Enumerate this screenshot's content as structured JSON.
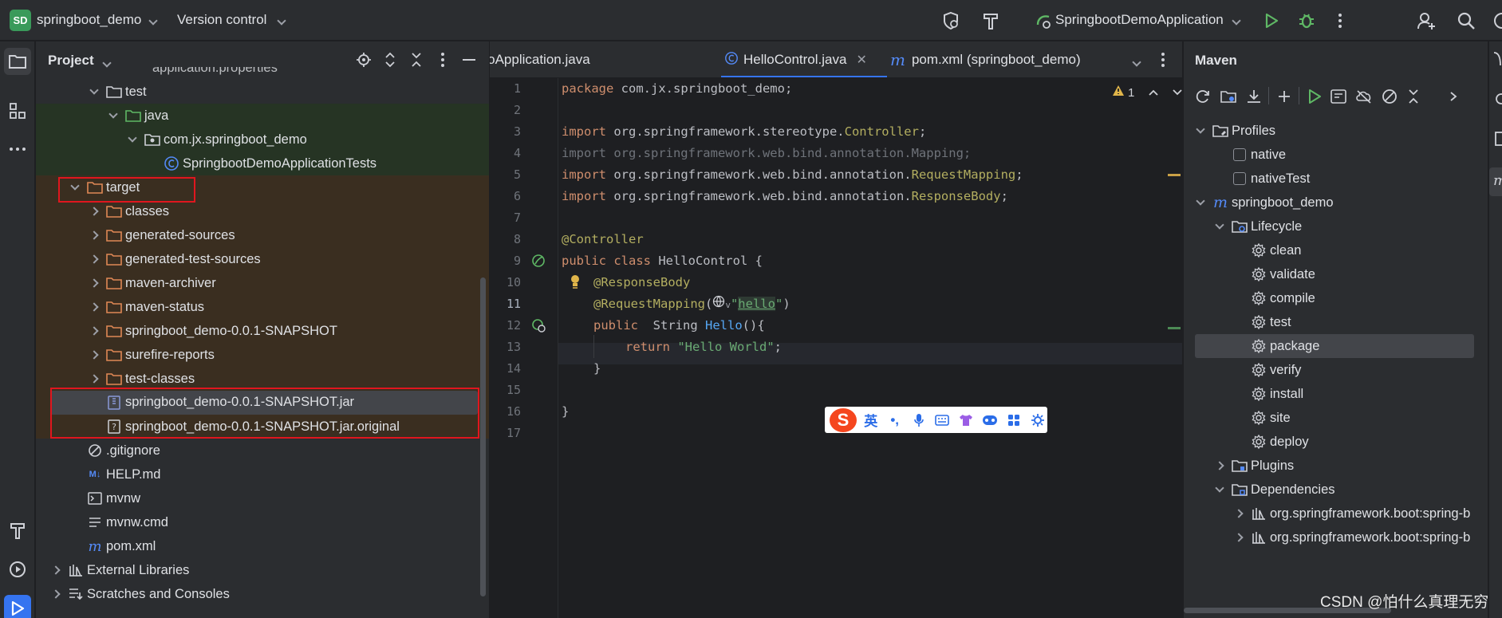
{
  "titlebar": {
    "project_badge": "SD",
    "project_name": "springboot_demo",
    "vcs_label": "Version control",
    "run_config": "SpringbootDemoApplication"
  },
  "project_panel": {
    "title": "Project",
    "partial_top_item": "application.properties",
    "tree": [
      {
        "label": "test",
        "icon": "folder-icon",
        "expanded": true
      },
      {
        "label": "java",
        "icon": "test-source-folder-icon",
        "expanded": true
      },
      {
        "label": "com.jx.springboot_demo",
        "icon": "package-icon",
        "expanded": true
      },
      {
        "label": "SpringbootDemoApplicationTests",
        "icon": "class-icon"
      },
      {
        "label": "target",
        "icon": "folder-icon",
        "expanded": true
      },
      {
        "label": "classes",
        "icon": "folder-icon",
        "expanded": false
      },
      {
        "label": "generated-sources",
        "icon": "folder-icon",
        "expanded": false
      },
      {
        "label": "generated-test-sources",
        "icon": "folder-icon",
        "expanded": false
      },
      {
        "label": "maven-archiver",
        "icon": "folder-icon",
        "expanded": false
      },
      {
        "label": "maven-status",
        "icon": "folder-icon",
        "expanded": false
      },
      {
        "label": "springboot_demo-0.0.1-SNAPSHOT",
        "icon": "folder-icon",
        "expanded": false
      },
      {
        "label": "surefire-reports",
        "icon": "folder-icon",
        "expanded": false
      },
      {
        "label": "test-classes",
        "icon": "folder-icon",
        "expanded": false
      },
      {
        "label": "springboot_demo-0.0.1-SNAPSHOT.jar",
        "icon": "jar-icon"
      },
      {
        "label": "springboot_demo-0.0.1-SNAPSHOT.jar.original",
        "icon": "unknown-file-icon"
      },
      {
        "label": ".gitignore",
        "icon": "ignore-file-icon"
      },
      {
        "label": "HELP.md",
        "icon": "markdown-icon"
      },
      {
        "label": "mvnw",
        "icon": "shell-icon"
      },
      {
        "label": "mvnw.cmd",
        "icon": "text-file-icon"
      },
      {
        "label": "pom.xml",
        "icon": "maven-icon"
      },
      {
        "label": "External Libraries",
        "icon": "library-icon",
        "expanded": false
      },
      {
        "label": "Scratches and Consoles",
        "icon": "scratches-icon",
        "expanded": false
      }
    ]
  },
  "editor": {
    "tabs": [
      {
        "label": "SpringbootDemoApplication.java"
      },
      {
        "label": "HelloControl.java",
        "active": true
      },
      {
        "label": "pom.xml (springboot_demo)"
      }
    ],
    "warning_count": "1",
    "line_numbers": [
      "1",
      "2",
      "3",
      "4",
      "5",
      "6",
      "7",
      "8",
      "9",
      "10",
      "11",
      "12",
      "13",
      "14",
      "15",
      "16",
      "17"
    ],
    "current_line": "11",
    "code": {
      "l1_kw": "package",
      "l1_rest": " com.jx.springboot_demo;",
      "l3_kw": "import",
      "l3_pkg": " org.springframework.stereotype.",
      "l3_cls": "Controller",
      "l3_end": ";",
      "l4_text": "import org.springframework.web.bind.annotation.Mapping;",
      "l5_kw": "import",
      "l5_pkg": " org.springframework.web.bind.annotation.",
      "l5_cls": "RequestMapping",
      "l5_end": ";",
      "l6_kw": "import",
      "l6_pkg": " org.springframework.web.bind.annotation.",
      "l6_cls": "ResponseBody",
      "l6_end": ";",
      "l8_ann": "@Controller",
      "l9_kw": "public class",
      "l9_rest": " HelloControl {",
      "l10_ann": "@ResponseBody",
      "l11_ann": "@RequestMapping",
      "l11_open": "(",
      "l11_chev": "v",
      "l11_q1": "\"",
      "l11_str": "hello",
      "l11_q2": "\"",
      "l11_close": ")",
      "l12_kw": "public",
      "l12_type": "  String ",
      "l12_fn": "Hello",
      "l12_end": "(){",
      "l13_kw": "return",
      "l13_str": " \"Hello World\"",
      "l13_end": ";",
      "l14": "}",
      "l16": "}"
    }
  },
  "ime_toolbar": {
    "logo": "S",
    "lang": "英",
    "punct": "•,"
  },
  "maven": {
    "title": "Maven",
    "items": [
      {
        "label": "Profiles",
        "level": 0
      },
      {
        "label": "native",
        "level": 1,
        "checkbox": true
      },
      {
        "label": "nativeTest",
        "level": 1,
        "checkbox": true
      },
      {
        "label": "springboot_demo",
        "level": 0
      },
      {
        "label": "Lifecycle",
        "level": 1
      },
      {
        "label": "clean",
        "level": 2
      },
      {
        "label": "validate",
        "level": 2
      },
      {
        "label": "compile",
        "level": 2
      },
      {
        "label": "test",
        "level": 2
      },
      {
        "label": "package",
        "level": 2,
        "selected": true
      },
      {
        "label": "verify",
        "level": 2
      },
      {
        "label": "install",
        "level": 2
      },
      {
        "label": "site",
        "level": 2
      },
      {
        "label": "deploy",
        "level": 2
      },
      {
        "label": "Plugins",
        "level": 1
      },
      {
        "label": "Dependencies",
        "level": 1
      },
      {
        "label": "org.springframework.boot:spring-b",
        "level": 2
      },
      {
        "label": "org.springframework.boot:spring-b",
        "level": 2
      }
    ]
  },
  "watermark": "CSDN @怕什么真理无穷",
  "colors": {
    "accent": "#3574f0",
    "highlight_box": "#e0161e",
    "run_green": "#5fb865"
  }
}
